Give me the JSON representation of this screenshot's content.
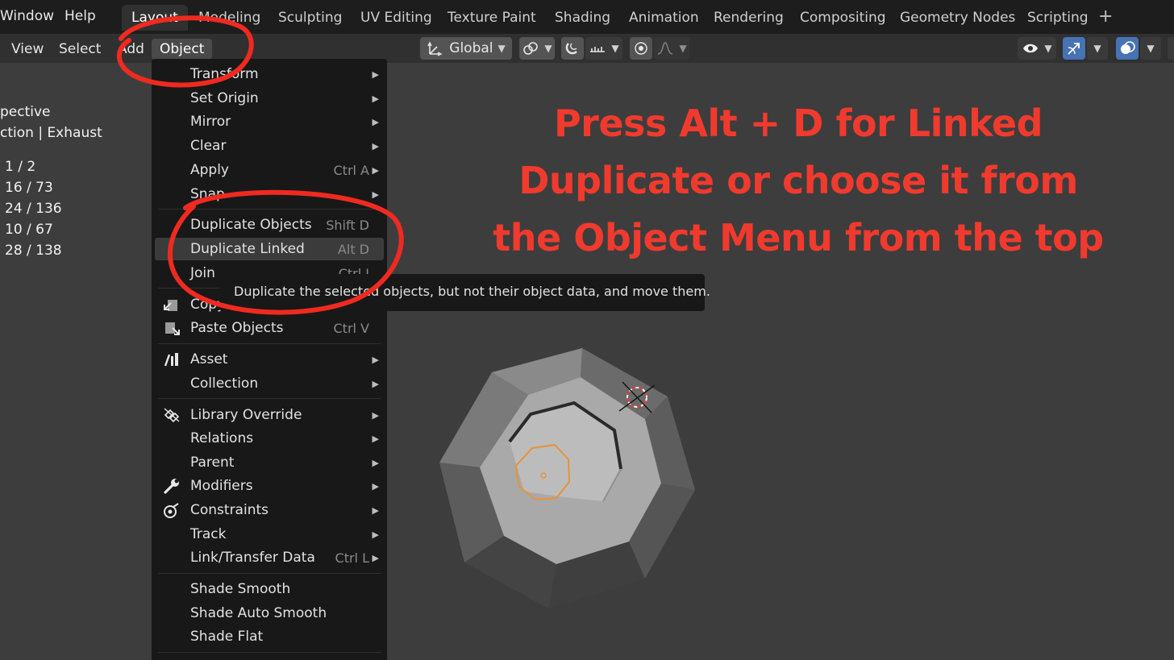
{
  "topbar": {
    "menus": [
      "Window",
      "Help"
    ],
    "tabs": [
      "Layout",
      "Modeling",
      "Sculpting",
      "UV Editing",
      "Texture Paint",
      "Shading",
      "Animation",
      "Rendering",
      "Compositing",
      "Geometry Nodes",
      "Scripting"
    ],
    "active_tab": "Layout",
    "add_tab_glyph": "+"
  },
  "header": {
    "menus": [
      "View",
      "Select",
      "Add",
      "Object"
    ],
    "active_menu": "Object",
    "orientation": "Global"
  },
  "viewport_info": {
    "mode": "pective",
    "collection": "ction | Exhaust",
    "stats": [
      "1 / 2",
      "16 / 73",
      "24 / 136",
      "10 / 67",
      "28 / 138"
    ]
  },
  "object_menu": {
    "items": [
      {
        "label": "Transform",
        "submenu": true
      },
      {
        "label": "Set Origin",
        "submenu": true
      },
      {
        "label": "Mirror",
        "submenu": true
      },
      {
        "label": "Clear",
        "submenu": true
      },
      {
        "label": "Apply",
        "shortcut": "Ctrl A",
        "submenu": true
      },
      {
        "label": "Snap",
        "submenu": true
      },
      {
        "label": "Duplicate Objects",
        "shortcut": "Shift D"
      },
      {
        "label": "Duplicate Linked",
        "shortcut": "Alt D",
        "highlighted": true
      },
      {
        "label": "Join",
        "shortcut": "Ctrl J"
      },
      {
        "label": "Copy Objects",
        "icon": "copy-icon"
      },
      {
        "label": "Paste Objects",
        "shortcut": "Ctrl V",
        "icon": "paste-icon"
      },
      {
        "label": "Asset",
        "submenu": true,
        "icon": "asset-icon"
      },
      {
        "label": "Collection",
        "submenu": true
      },
      {
        "label": "Library Override",
        "submenu": true,
        "icon": "library-override-icon"
      },
      {
        "label": "Relations",
        "submenu": true
      },
      {
        "label": "Parent",
        "submenu": true
      },
      {
        "label": "Modifiers",
        "submenu": true,
        "icon": "wrench-icon"
      },
      {
        "label": "Constraints",
        "submenu": true,
        "icon": "constraint-icon"
      },
      {
        "label": "Track",
        "submenu": true
      },
      {
        "label": "Link/Transfer Data",
        "shortcut": "Ctrl L",
        "submenu": true
      },
      {
        "label": "Shade Smooth"
      },
      {
        "label": "Shade Auto Smooth"
      },
      {
        "label": "Shade Flat"
      }
    ]
  },
  "tooltip": {
    "text": "Duplicate the selected objects, but not their object data, and move them."
  },
  "annotation": {
    "lines": [
      "Press Alt + D for Linked",
      "Duplicate or choose it from",
      "the Object Menu from the top"
    ],
    "color": "#f03a2e"
  },
  "colors": {
    "topbar_bg": "#1d1d1d",
    "header_bg": "#303030",
    "viewport_bg": "#3d3d3d",
    "menu_bg": "#181818",
    "highlight_bg": "#3b3b3b",
    "accent_blue": "#4772b3",
    "selection_orange": "#e8923a"
  }
}
